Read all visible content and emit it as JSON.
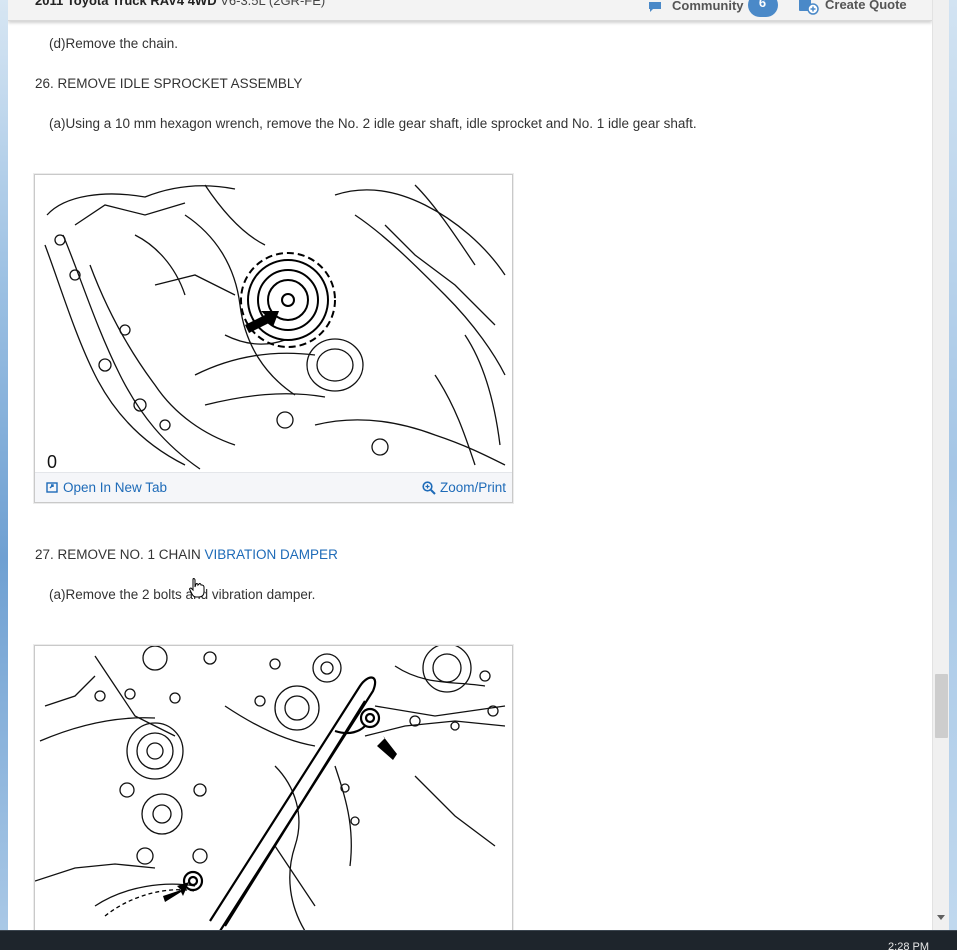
{
  "header": {
    "vehicle_model": "2011 Toyota Truck RAV4 4WD",
    "vehicle_engine": "V6-3.5L (2GR-FE)",
    "community_label": "Community",
    "community_count": "6",
    "create_quote_label": "Create Quote"
  },
  "content": {
    "step_d": "(d)Remove the chain.",
    "section_26": "26. REMOVE IDLE SPROCKET ASSEMBLY",
    "step_26a": "(a)Using a 10 mm hexagon wrench, remove the No. 2 idle gear shaft, idle sprocket and No. 1 idle gear shaft.",
    "figure1": {
      "corner_label": "0",
      "open_label": "Open In New Tab",
      "zoom_label": "Zoom/Print"
    },
    "section_27_prefix": "27. REMOVE NO. 1 CHAIN ",
    "section_27_link": "VIBRATION DAMPER",
    "step_27a": "(a)Remove the 2 bolts and vibration damper."
  },
  "taskbar": {
    "clock": "2:28 PM"
  },
  "colors": {
    "link": "#1e6bb8",
    "badge": "#4a89c8",
    "header_bg": "#f3f3f3"
  }
}
